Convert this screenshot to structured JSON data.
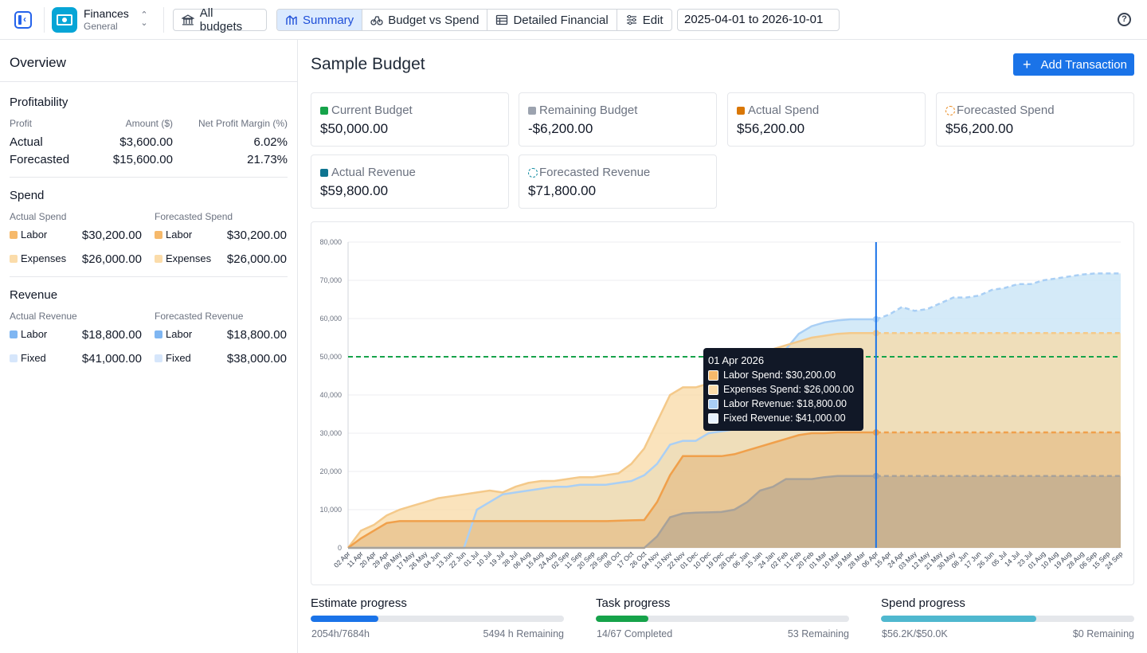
{
  "topbar": {
    "app_name": "Finances",
    "app_sub": "General",
    "all_budgets": "All budgets",
    "tabs": [
      "Summary",
      "Budget vs Spend",
      "Detailed Financial",
      "Edit"
    ],
    "active_tab": "Summary",
    "date_range": "2025-04-01 to 2026-10-01",
    "help": "?"
  },
  "overview": {
    "title": "Overview",
    "profitability": {
      "title": "Profitability",
      "headers": [
        "Profit",
        "Amount ($)",
        "Net Profit Margin (%)"
      ],
      "rows": [
        {
          "label": "Actual",
          "amount": "$3,600.00",
          "margin": "6.02%"
        },
        {
          "label": "Forecasted",
          "amount": "$15,600.00",
          "margin": "21.73%"
        }
      ]
    },
    "spend": {
      "title": "Spend",
      "actual_header": "Actual Spend",
      "forecast_header": "Forecasted Spend",
      "actual": [
        {
          "label": "Labor",
          "value": "$30,200.00",
          "color": "#f6b96b"
        },
        {
          "label": "Expenses",
          "value": "$26,000.00",
          "color": "#fbdcaa"
        }
      ],
      "forecast": [
        {
          "label": "Labor",
          "value": "$30,200.00",
          "color": "#f6b96b"
        },
        {
          "label": "Expenses",
          "value": "$26,000.00",
          "color": "#fbdcaa"
        }
      ]
    },
    "revenue": {
      "title": "Revenue",
      "actual_header": "Actual Revenue",
      "forecast_header": "Forecasted Revenue",
      "actual": [
        {
          "label": "Labor",
          "value": "$18,800.00",
          "color": "#7fb6f2"
        },
        {
          "label": "Fixed",
          "value": "$41,000.00",
          "color": "#d6e6fb"
        }
      ],
      "forecast": [
        {
          "label": "Labor",
          "value": "$18,800.00",
          "color": "#7fb6f2"
        },
        {
          "label": "Fixed",
          "value": "$38,000.00",
          "color": "#d6e6fb"
        }
      ]
    }
  },
  "main": {
    "title": "Sample Budget",
    "add_button": "Add Transaction",
    "cards": [
      {
        "label": "Current Budget",
        "value": "$50,000.00",
        "color": "#16a34a",
        "dashed": false
      },
      {
        "label": "Remaining Budget",
        "value": "-$6,200.00",
        "color": "#9ca3af",
        "dashed": false
      },
      {
        "label": "Actual Spend",
        "value": "$56,200.00",
        "color": "#d97706",
        "dashed": false
      },
      {
        "label": "Forecasted Spend",
        "value": "$56,200.00",
        "color": "#ea8a1f",
        "dashed": true
      },
      {
        "label": "Actual Revenue",
        "value": "$59,800.00",
        "color": "#0e7490",
        "dashed": false
      },
      {
        "label": "Forecasted Revenue",
        "value": "$71,800.00",
        "color": "#0e8aa0",
        "dashed": true
      }
    ]
  },
  "tooltip": {
    "title": "01 Apr 2026",
    "rows": [
      {
        "label": "Labor Spend: $30,200.00",
        "color": "#f6b96b"
      },
      {
        "label": "Expenses Spend: $26,000.00",
        "color": "#fbdcaa"
      },
      {
        "label": "Labor Revenue: $18,800.00",
        "color": "#a9cff5"
      },
      {
        "label": "Fixed Revenue: $41,000.00",
        "color": "#e6f1fd"
      }
    ]
  },
  "progress": [
    {
      "label": "Estimate progress",
      "left": "2054h/7684h",
      "right": "5494 h Remaining",
      "fraction": 0.267,
      "color": "#1a73e8"
    },
    {
      "label": "Task progress",
      "left": "14/67 Completed",
      "right": "53 Remaining",
      "fraction": 0.209,
      "color": "#16a34a"
    },
    {
      "label": "Spend progress",
      "left": "$56.2K/$50.0K",
      "right": "$0 Remaining",
      "fraction": 0.614,
      "color": "#4fb8cf"
    }
  ],
  "chart_data": {
    "type": "area",
    "x": [
      "02 Apr",
      "11 Apr",
      "20 Apr",
      "29 Apr",
      "08 May",
      "17 May",
      "26 May",
      "04 Jun",
      "13 Jun",
      "22 Jun",
      "01 Jul",
      "10 Jul",
      "19 Jul",
      "28 Jul",
      "06 Aug",
      "15 Aug",
      "24 Aug",
      "02 Sep",
      "11 Sep",
      "20 Sep",
      "29 Sep",
      "08 Oct",
      "17 Oct",
      "26 Oct",
      "04 Nov",
      "13 Nov",
      "22 Nov",
      "01 Dec",
      "10 Dec",
      "19 Dec",
      "28 Dec",
      "06 Jan",
      "15 Jan",
      "24 Jan",
      "02 Feb",
      "11 Feb",
      "20 Feb",
      "01 Mar",
      "10 Mar",
      "19 Mar",
      "28 Mar",
      "06 Apr",
      "15 Apr",
      "24 Apr",
      "03 May",
      "12 May",
      "21 May",
      "30 May",
      "08 Jun",
      "17 Jun",
      "26 Jun",
      "05 Jul",
      "14 Jul",
      "23 Jul",
      "01 Aug",
      "10 Aug",
      "19 Aug",
      "28 Aug",
      "06 Sep",
      "15 Sep",
      "24 Sep"
    ],
    "ylim": [
      0,
      80000
    ],
    "yticks": [
      0,
      10000,
      20000,
      30000,
      40000,
      50000,
      60000,
      70000,
      80000
    ],
    "ytick_labels": [
      "0",
      "10,000",
      "20,000",
      "30,000",
      "40,000",
      "50,000",
      "60,000",
      "70,000",
      "80,000"
    ],
    "budget_line": 50000,
    "current_index": 41,
    "series": [
      {
        "name": "Labor Revenue",
        "color": "#b8a890",
        "values": [
          0,
          0,
          0,
          0,
          0,
          0,
          0,
          0,
          0,
          0,
          0,
          0,
          0,
          0,
          0,
          0,
          0,
          0,
          0,
          0,
          0,
          0,
          0,
          0,
          3000,
          8000,
          9000,
          9200,
          9300,
          9400,
          10000,
          12000,
          15000,
          16000,
          18000,
          18000,
          18000,
          18500,
          18800,
          18800,
          18800,
          18800,
          18800,
          18800,
          18800,
          18800,
          18800,
          18800,
          18800,
          18800,
          18800,
          18800,
          18800,
          18800,
          18800,
          18800,
          18800,
          18800,
          18800,
          18800,
          18800
        ]
      },
      {
        "name": "Labor Spend",
        "color": "#f0a04b",
        "values": [
          0,
          2500,
          4500,
          6500,
          7000,
          7000,
          7000,
          7000,
          7000,
          7000,
          7000,
          7000,
          7000,
          7000,
          7000,
          7000,
          7000,
          7000,
          7000,
          7000,
          7000,
          7100,
          7200,
          7300,
          12000,
          19000,
          24000,
          24000,
          24000,
          24000,
          24500,
          25500,
          26500,
          27500,
          28500,
          29500,
          30000,
          30000,
          30200,
          30200,
          30200,
          30200,
          30200,
          30200,
          30200,
          30200,
          30200,
          30200,
          30200,
          30200,
          30200,
          30200,
          30200,
          30200,
          30200,
          30200,
          30200,
          30200,
          30200,
          30200,
          30200
        ]
      },
      {
        "name": "Total Revenue",
        "color": "#a9cff5",
        "values": [
          0,
          0,
          0,
          0,
          0,
          0,
          0,
          0,
          0,
          0,
          10000,
          12000,
          14000,
          14500,
          15000,
          15500,
          16000,
          16000,
          16500,
          16500,
          16500,
          17000,
          17500,
          19000,
          22000,
          27000,
          28000,
          28000,
          30000,
          30500,
          31000,
          34000,
          38000,
          45000,
          52000,
          56000,
          58000,
          59000,
          59500,
          59800,
          59800,
          59800,
          61000,
          63000,
          62000,
          62500,
          64000,
          65500,
          65500,
          66000,
          67500,
          68000,
          69000,
          69000,
          70000,
          70500,
          71000,
          71500,
          71800,
          71800,
          71800
        ]
      },
      {
        "name": "Total Spend",
        "color": "#fbdcaa",
        "values": [
          0,
          4500,
          6000,
          8500,
          10000,
          11000,
          12000,
          13000,
          13500,
          14000,
          14500,
          15000,
          14500,
          16000,
          17000,
          17500,
          17500,
          18000,
          18500,
          18500,
          19000,
          19500,
          22000,
          26000,
          33000,
          40000,
          42000,
          42000,
          43000,
          44500,
          46000,
          48000,
          50000,
          52000,
          53000,
          54000,
          55000,
          55500,
          56000,
          56200,
          56200,
          56200,
          56200,
          56200,
          56200,
          56200,
          56200,
          56200,
          56200,
          56200,
          56200,
          56200,
          56200,
          56200,
          56200,
          56200,
          56200,
          56200,
          56200,
          56200,
          56200
        ]
      }
    ]
  }
}
